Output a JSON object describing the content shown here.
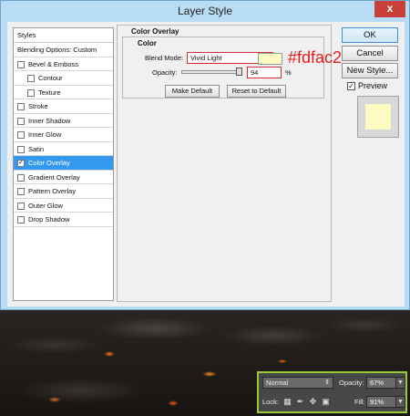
{
  "dialog": {
    "title": "Layer Style",
    "close_glyph": "x"
  },
  "styles_list": {
    "header": "Styles",
    "items": [
      {
        "label": "Blending Options: Custom",
        "checkbox": false,
        "checked": false,
        "indent": 0
      },
      {
        "label": "Bevel & Emboss",
        "checkbox": true,
        "checked": false,
        "indent": 0
      },
      {
        "label": "Contour",
        "checkbox": true,
        "checked": false,
        "indent": 1
      },
      {
        "label": "Texture",
        "checkbox": true,
        "checked": false,
        "indent": 1
      },
      {
        "label": "Stroke",
        "checkbox": true,
        "checked": false,
        "indent": 0
      },
      {
        "label": "Inner Shadow",
        "checkbox": true,
        "checked": false,
        "indent": 0
      },
      {
        "label": "Inner Glow",
        "checkbox": true,
        "checked": false,
        "indent": 0
      },
      {
        "label": "Satin",
        "checkbox": true,
        "checked": false,
        "indent": 0
      },
      {
        "label": "Color Overlay",
        "checkbox": true,
        "checked": true,
        "indent": 0,
        "selected": true
      },
      {
        "label": "Gradient Overlay",
        "checkbox": true,
        "checked": false,
        "indent": 0
      },
      {
        "label": "Pattern Overlay",
        "checkbox": true,
        "checked": false,
        "indent": 0
      },
      {
        "label": "Outer Glow",
        "checkbox": true,
        "checked": false,
        "indent": 0
      },
      {
        "label": "Drop Shadow",
        "checkbox": true,
        "checked": false,
        "indent": 0
      }
    ]
  },
  "color_overlay": {
    "group_title": "Color Overlay",
    "sub_title": "Color",
    "blend_mode_label": "Blend Mode:",
    "blend_mode_value": "Vivid Light",
    "swatch_color": "#fdfac2",
    "hex_annotation": "#fdfac2",
    "opacity_label": "Opacity:",
    "opacity_value": "94",
    "opacity_unit": "%",
    "opacity_level": 0.94,
    "make_default": "Make Default",
    "reset_default": "Reset to Default"
  },
  "right_buttons": {
    "ok": "OK",
    "cancel": "Cancel",
    "new_style": "New Style...",
    "preview_label": "Preview",
    "preview_checked": true
  },
  "layers_panel": {
    "blend_mode": "Normal",
    "opacity_label": "Opacity:",
    "opacity_value": "67%",
    "lock_label": "Lock:",
    "fill_label": "Fill:",
    "fill_value": "91%",
    "lock_icons": [
      "transparency-lock-icon",
      "brush-lock-icon",
      "move-lock-icon",
      "padlock-icon"
    ]
  },
  "colors": {
    "title_bar": "#b8dcf4",
    "selection": "#3399ee",
    "annotation_red": "#e51c1c",
    "overlay_color": "#fdfac2",
    "highlight_border": "#9bc836"
  }
}
